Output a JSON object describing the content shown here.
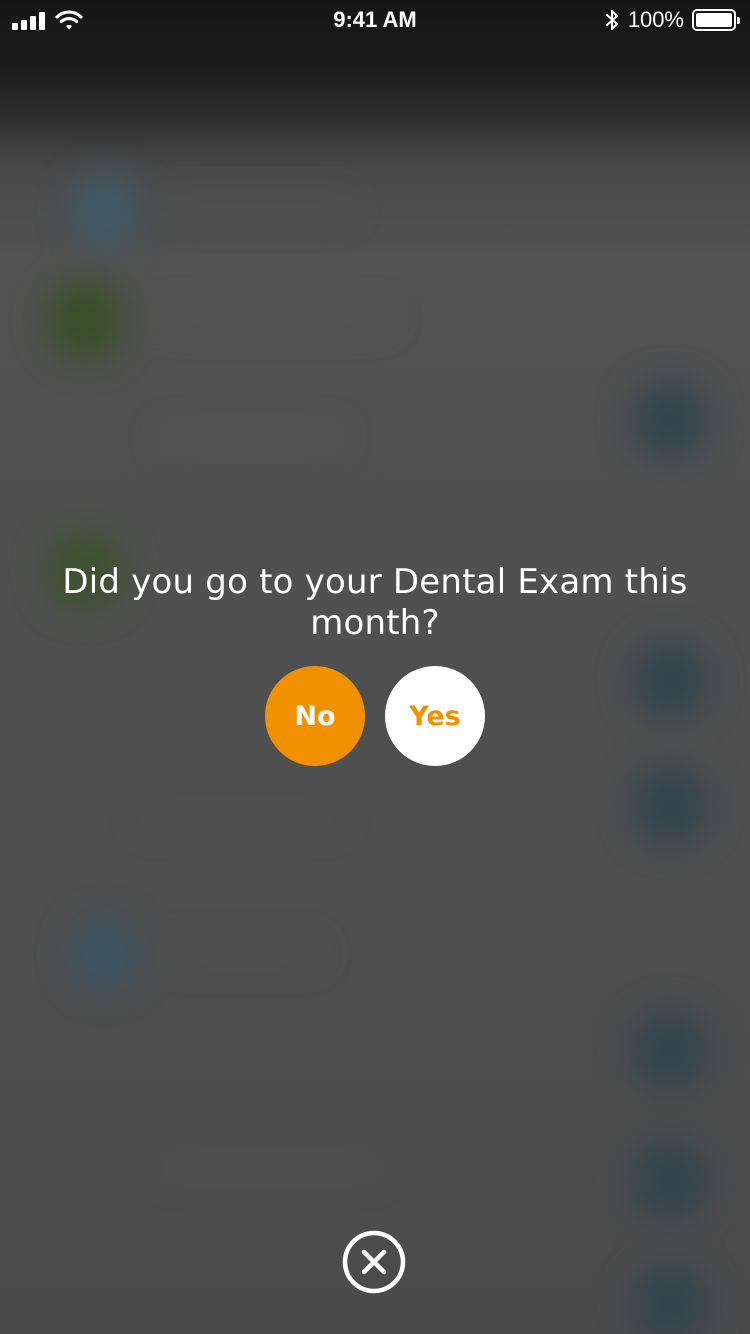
{
  "status_bar": {
    "time": "9:41 AM",
    "battery_percent": "100%",
    "battery_level": 1.0,
    "icons": [
      "cellular-signal-icon",
      "wifi-icon",
      "bluetooth-icon",
      "battery-icon"
    ]
  },
  "prompt": {
    "question": "Did you go to your Dental Exam this month?",
    "answers": {
      "no_label": "No",
      "yes_label": "Yes"
    }
  },
  "close": {
    "icon": "close-circle-icon"
  },
  "colors": {
    "accent": "#F29100",
    "button_light": "#FFFFFF",
    "overlay_text": "#FFFFFF"
  }
}
